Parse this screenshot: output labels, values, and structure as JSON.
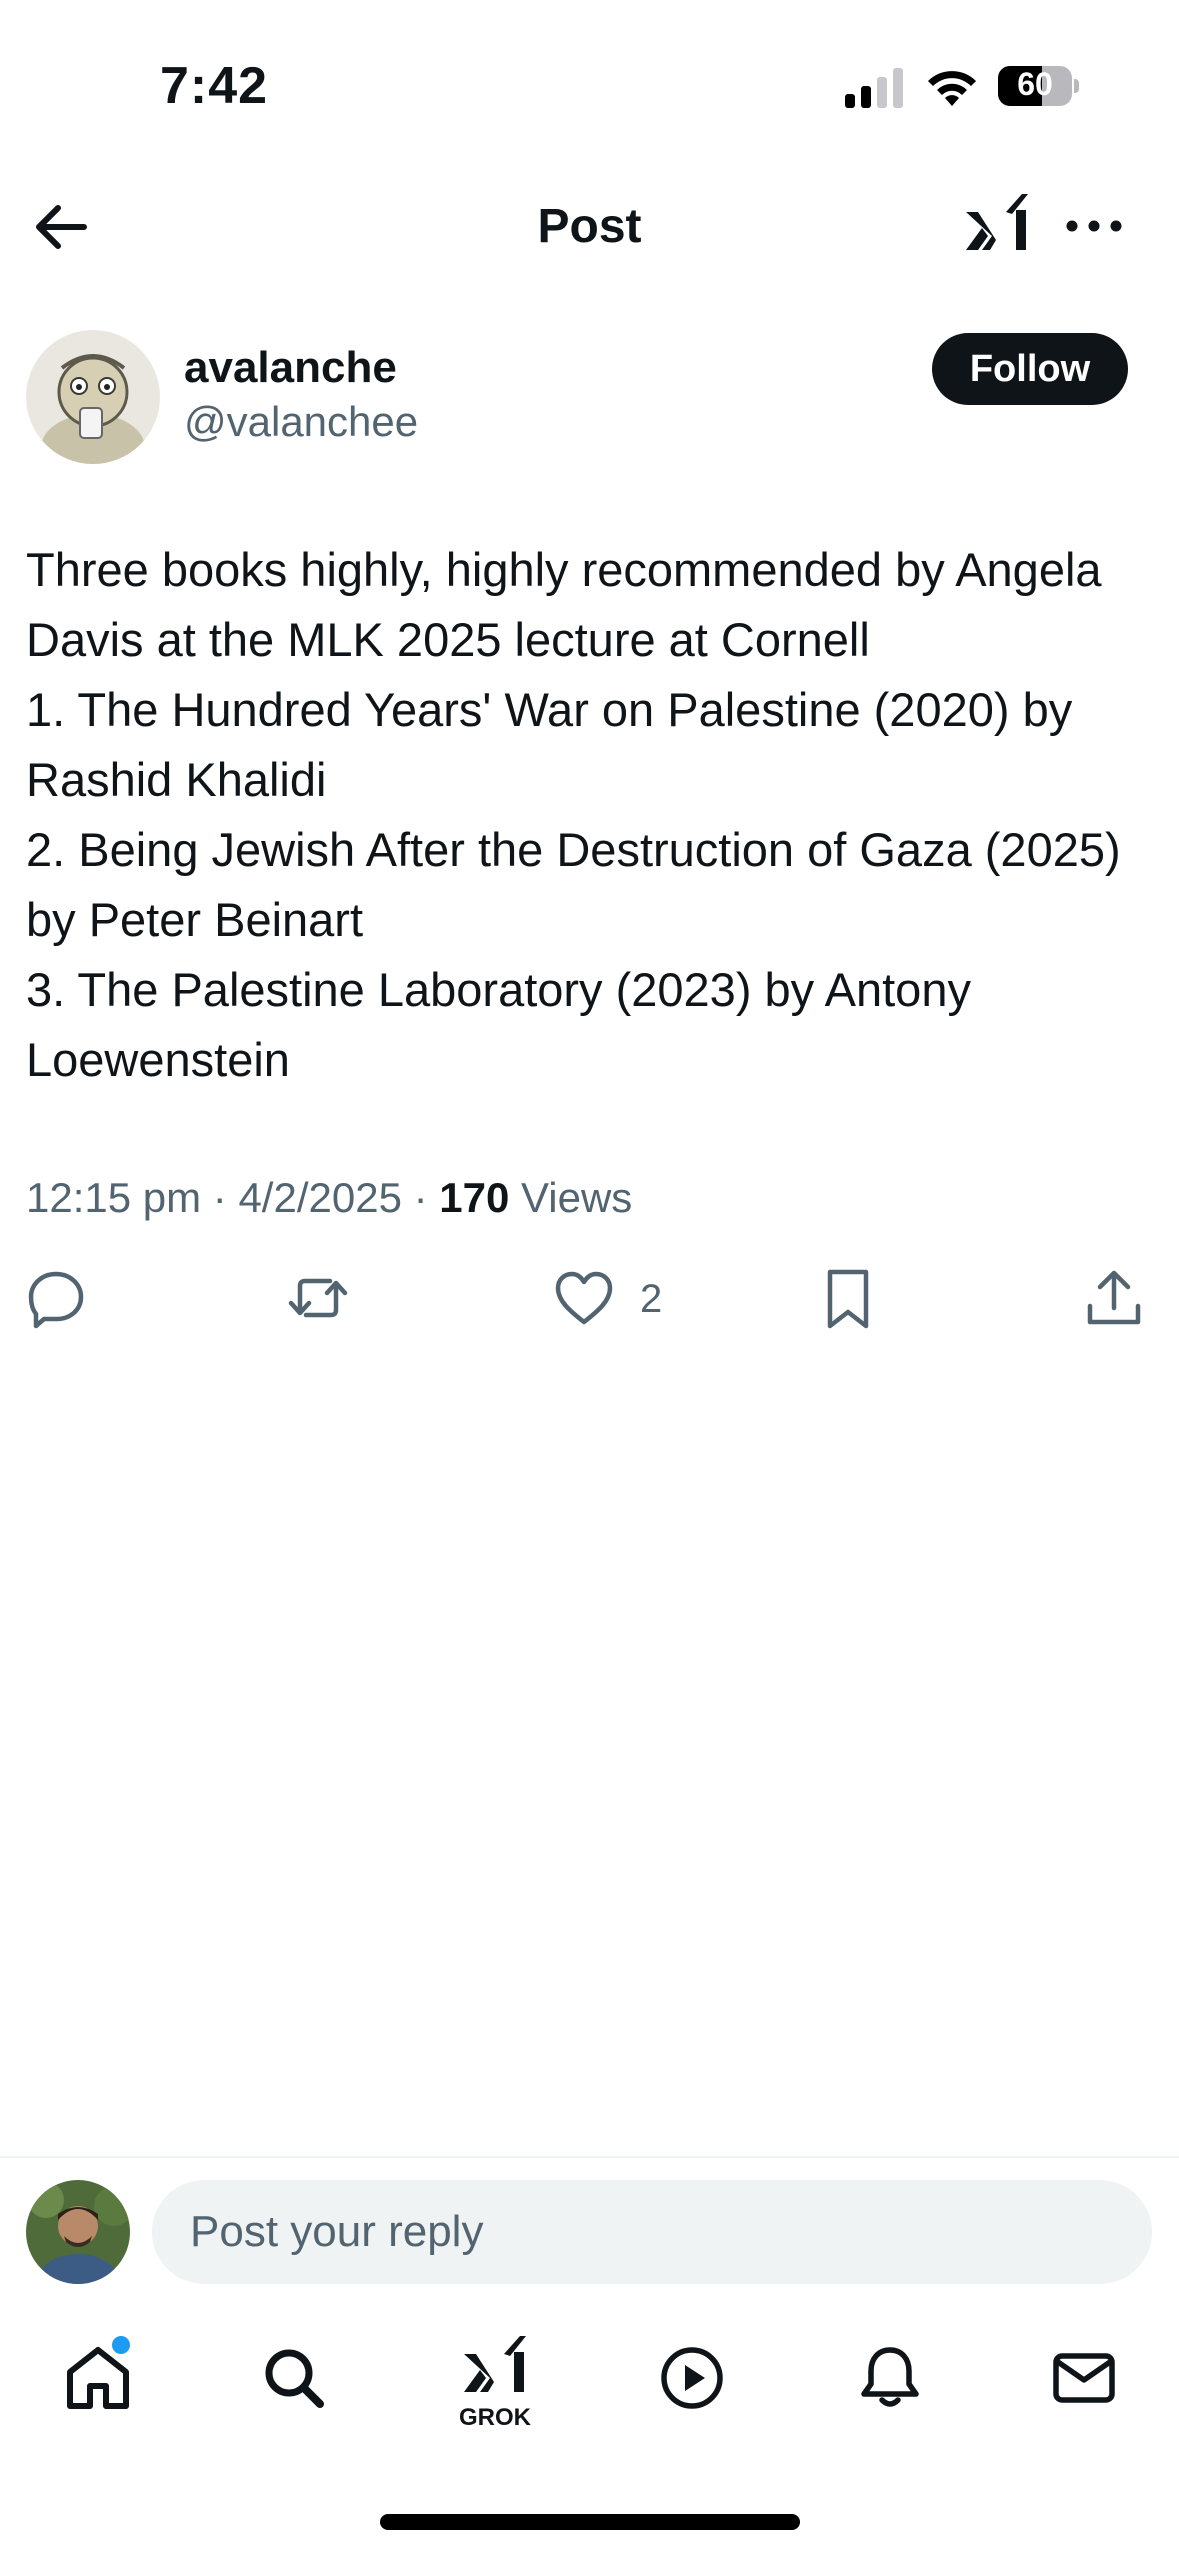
{
  "status_bar": {
    "time": "7:42",
    "battery": "60",
    "battery_level": 0.6
  },
  "header": {
    "title": "Post"
  },
  "author": {
    "name": "avalanche",
    "handle": "@valanchee",
    "follow_label": "Follow"
  },
  "post": {
    "text": "Three books highly, highly recommended by Angela Davis at the MLK 2025 lecture at Cornell\n1. The Hundred Years' War on Palestine (2020) by Rashid Khalidi\n2. Being Jewish After the Destruction of Gaza (2025) by Peter Beinart\n3. The Palestine Laboratory (2023) by Antony Loewenstein",
    "time": "12:15 pm",
    "date": "4/2/2025",
    "views_count": "170",
    "views_label": "Views",
    "like_count": "2"
  },
  "reply": {
    "placeholder": "Post your reply"
  },
  "tab_bar": {
    "grok_label": "GROK"
  },
  "colors": {
    "accent": "#1d9bf0",
    "text": "#0f1419",
    "secondary": "#536471",
    "surface": "#eff3f4"
  }
}
